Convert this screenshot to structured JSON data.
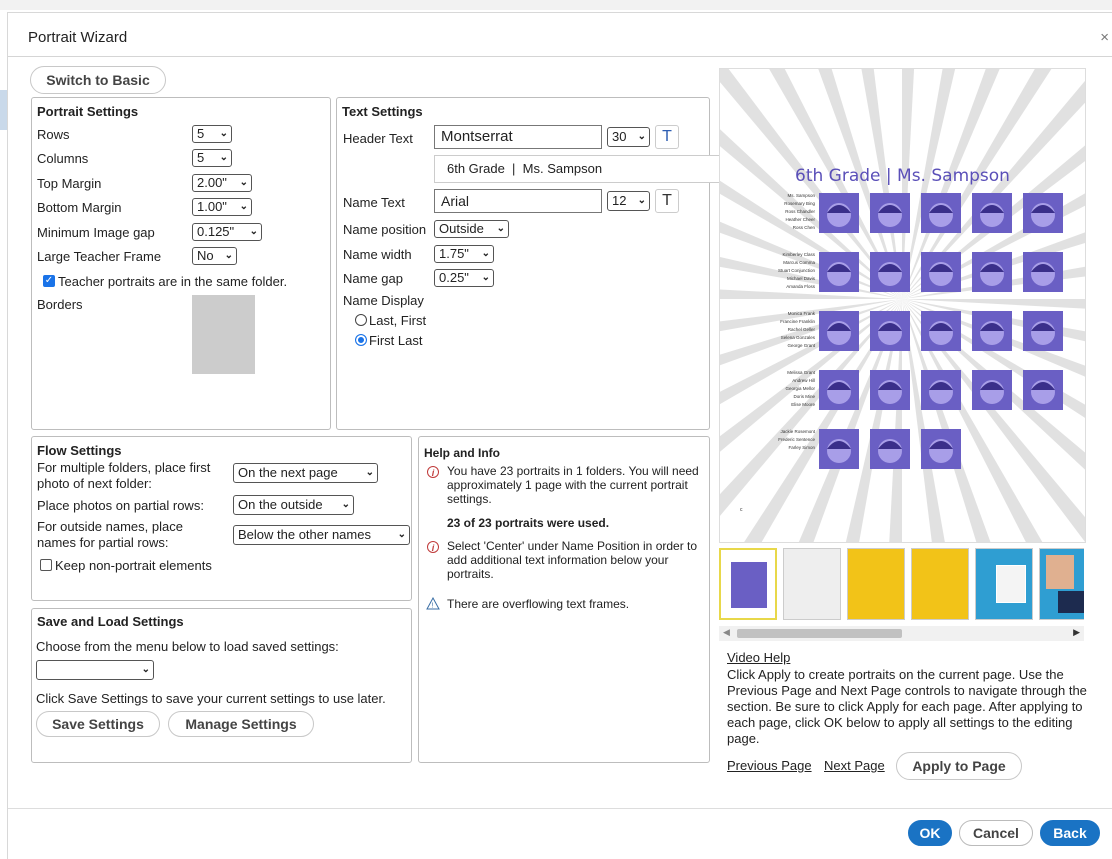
{
  "dialog": {
    "title": "Portrait Wizard",
    "close_icon": "×"
  },
  "switch_basic": "Switch to Basic",
  "portrait_settings": {
    "title": "Portrait Settings",
    "rows_label": "Rows",
    "rows_value": "5",
    "columns_label": "Columns",
    "columns_value": "5",
    "top_margin_label": "Top Margin",
    "top_margin_value": "2.00\"",
    "bottom_margin_label": "Bottom Margin",
    "bottom_margin_value": "1.00\"",
    "min_gap_label": "Minimum Image gap",
    "min_gap_value": "0.125\"",
    "teacher_frame_label": "Large Teacher Frame",
    "teacher_frame_value": "No",
    "teacher_same_folder": "Teacher portraits are in the same folder.",
    "teacher_same_folder_checked": true,
    "borders_label": "Borders",
    "border_swatch_color": "#cccccc"
  },
  "text_settings": {
    "title": "Text Settings",
    "header_label": "Header Text",
    "header_font": "Montserrat",
    "header_size": "30",
    "header_text_value": "6th Grade  |  Ms. Sampson",
    "name_label": "Name Text",
    "name_font": "Arial",
    "name_size": "12",
    "name_position_label": "Name position",
    "name_position_value": "Outside",
    "name_width_label": "Name width",
    "name_width_value": "1.75\"",
    "name_gap_label": "Name gap",
    "name_gap_value": "0.25\"",
    "name_display_label": "Name Display",
    "option_last_first": "Last, First",
    "option_first_last": "First Last",
    "selected": "First Last",
    "t_icon": "T"
  },
  "flow_settings": {
    "title": "Flow Settings",
    "multi_folder_label": "For multiple folders, place first photo of next folder:",
    "multi_folder_value": "On the next page",
    "partial_rows_label": "Place photos on partial rows:",
    "partial_rows_value": "On the outside",
    "outside_names_label": "For outside names, place names for partial rows:",
    "outside_names_value": "Below the other names",
    "keep_non_portrait": "Keep non-portrait elements",
    "keep_non_portrait_checked": false
  },
  "save_load": {
    "title": "Save and Load Settings",
    "choose_text": "Choose from the menu below to load saved settings:",
    "dropdown_value": "",
    "save_hint": "Click Save Settings to save your current settings to use later.",
    "save_button": "Save Settings",
    "manage_button": "Manage Settings"
  },
  "help": {
    "title": "Help and Info",
    "info1": "You have 23 portraits in 1 folders. You will need approximately 1 page with the current portrait settings.",
    "info1_bold": "23 of 23 portraits were used.",
    "info2": "Select 'Center' under Name Position in order to add additional text information below your portraits.",
    "warning": "There are overflowing text frames.",
    "info_icon": "i",
    "warning_icon": "!"
  },
  "preview": {
    "header": "6th Grade | Ms. Sampson",
    "rows": [
      [
        "Ms. Sampson",
        "Rosemary Bing",
        "Ross Chandler",
        "Heather Cheer",
        "Ross Chen"
      ],
      [
        "Kimberley Class",
        "Marcus Comma",
        "Stuart Conjunction",
        "Michael Davis",
        "Amanda Floss"
      ],
      [
        "Monica Frank",
        "Francine Franklin",
        "Rachel Geller",
        "Selena Gonzales",
        "George Grant"
      ],
      [
        "Melissa Grant",
        "Andrew Hill",
        "Georgia Mellor",
        "Doris Mine",
        "Elise Moore"
      ],
      [
        "Jackie Rosemont",
        "Frederic Sentence",
        "Farley Simon"
      ]
    ],
    "footer_mark": "c",
    "tile_color": "#6a5fc4",
    "header_color": "#5a4fb8",
    "thumb_colors": [
      "#6a5fc4",
      "#e8e8e8",
      "#f2c318",
      "#f2c318",
      "#2f9ed2",
      "#2f9ed2"
    ]
  },
  "side": {
    "video_help": "Video Help",
    "help_text": "Click Apply to create portraits on the current page. Use the Previous Page and Next Page controls to navigate through the section. Be sure to click Apply for each page. After applying to each page, click OK below to apply all settings to the editing page.",
    "previous_page": "Previous Page",
    "next_page": "Next Page",
    "apply_page": "Apply to Page"
  },
  "footer": {
    "ok": "OK",
    "cancel": "Cancel",
    "back": "Back",
    "accent": "#1a73c4"
  }
}
